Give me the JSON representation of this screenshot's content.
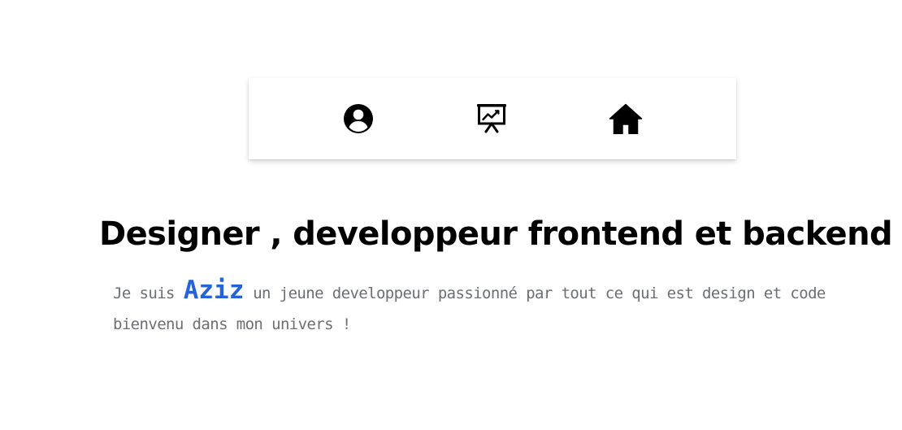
{
  "nav": {
    "items": [
      {
        "icon": "user-circle-icon",
        "label": ""
      },
      {
        "icon": "presentation-chart-icon",
        "label": ""
      },
      {
        "icon": "home-icon",
        "label": ""
      }
    ]
  },
  "hero": {
    "headline": "Designer , developpeur frontend et backend",
    "intro_before": "Je suis ",
    "name": "Aziz",
    "intro_after": " un jeune developpeur passionné par tout ce qui est design et code bienvenu dans mon univers !"
  },
  "colors": {
    "accent": "#2563d6",
    "body_text": "#6b6e73",
    "headline": "#000000",
    "background": "#ffffff"
  }
}
